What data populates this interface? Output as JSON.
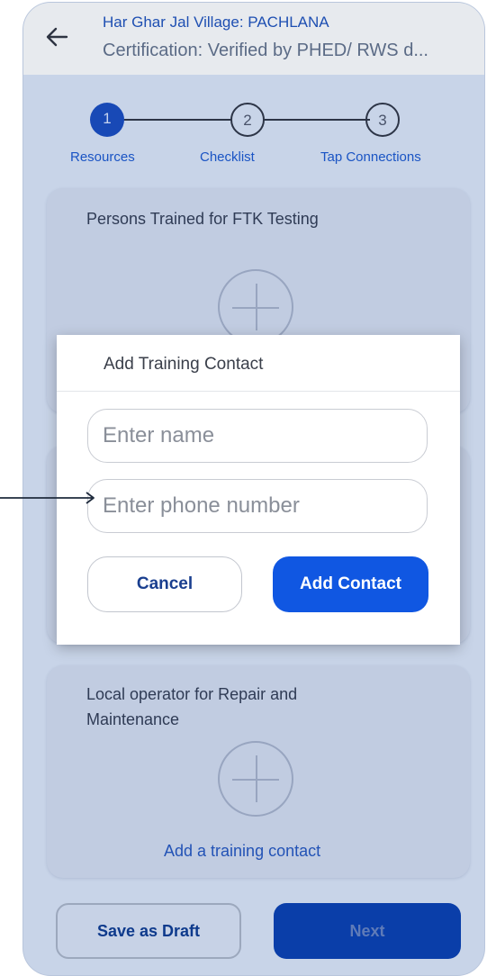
{
  "header": {
    "title": "Har Ghar Jal Village: PACHLANA",
    "subtitle": "Certification: Verified by PHED/ RWS d..."
  },
  "stepper": [
    {
      "number": "1",
      "label": "Resources",
      "state": "active"
    },
    {
      "number": "2",
      "label": "Checklist",
      "state": "inactive"
    },
    {
      "number": "3",
      "label": "Tap Connections",
      "state": "inactive"
    }
  ],
  "cards": {
    "ftk": {
      "title": "Persons Trained for FTK Testing"
    },
    "operator": {
      "title": "Local operator for Repair and Maintenance",
      "add_label": "Add a training contact"
    }
  },
  "footer": {
    "save_draft_label": "Save as Draft",
    "next_label": "Next"
  },
  "modal": {
    "title": "Add Training Contact",
    "name_placeholder": "Enter name",
    "name_value": "",
    "phone_placeholder": "Enter phone number",
    "phone_value": "",
    "cancel_label": "Cancel",
    "add_label": "Add Contact"
  },
  "colors": {
    "primary": "#1057e2",
    "overlay": "#c8d4e8"
  }
}
